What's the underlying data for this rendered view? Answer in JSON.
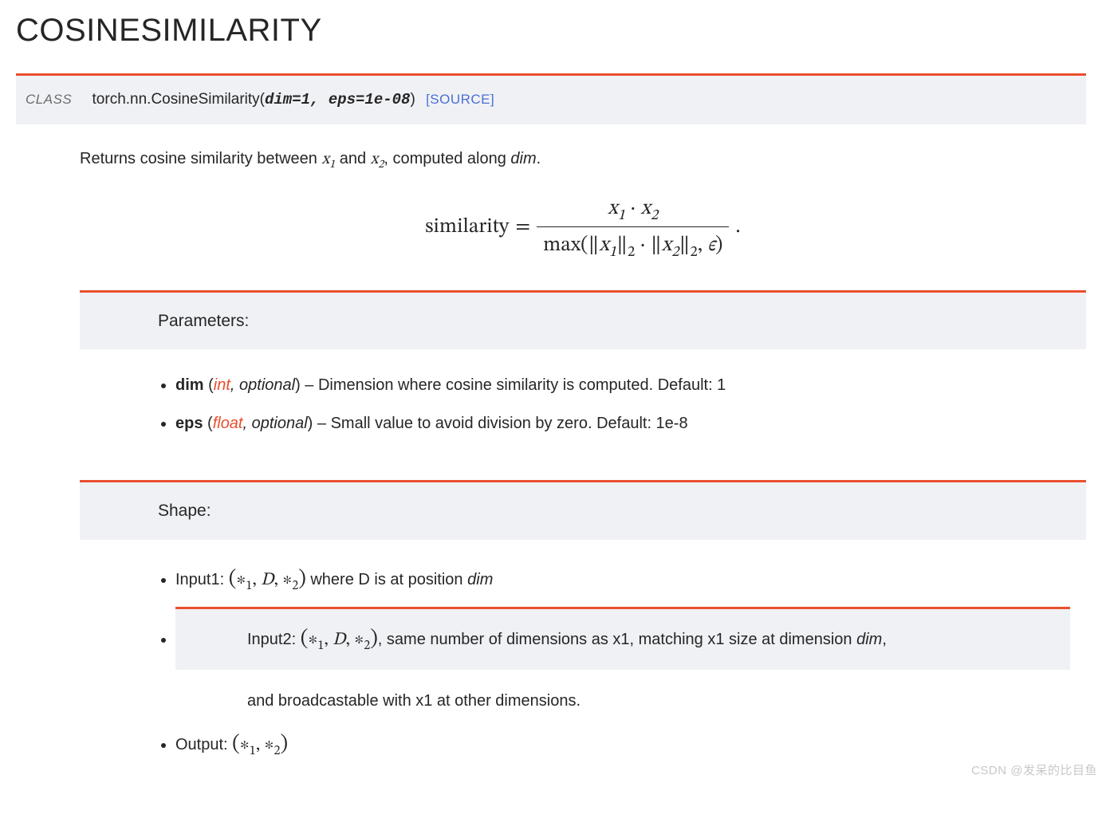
{
  "title": "COSINESIMILARITY",
  "signature": {
    "keyword": "CLASS",
    "path": "torch.nn.CosineSimilarity",
    "open": "(",
    "arg1_name": "dim=1",
    "sep": ", ",
    "arg2_name": "eps=1e-08",
    "close": ")",
    "source": "[SOURCE]"
  },
  "desc": {
    "t1": "Returns cosine similarity between ",
    "x": "x",
    "s1": "1",
    "t2": " and ",
    "s2": "2",
    "t3": ", computed along ",
    "dim": "dim",
    "t4": "."
  },
  "formula": {
    "lhs": "similarity",
    "eq": "=",
    "num": {
      "x": "x",
      "s1": "1",
      "dot": " · ",
      "s2": "2"
    },
    "den": {
      "max": "max(",
      "bb": "∥",
      "x": "x",
      "s1": "1",
      "s2": "2",
      "n2": "2",
      "dot": " · ",
      "comma": ", ",
      "eps": "ϵ",
      "close": ")"
    },
    "period": "."
  },
  "params": {
    "label": "Parameters:",
    "items": [
      {
        "name": "dim",
        "open": " (",
        "type": "int",
        "opt": ", optional",
        "close": ") – ",
        "desc": "Dimension where cosine similarity is computed. Default: 1"
      },
      {
        "name": "eps",
        "open": " (",
        "type": "float",
        "opt": ", optional",
        "close": ") – ",
        "desc": "Small value to avoid division by zero. Default: 1e-8"
      }
    ]
  },
  "shape": {
    "label": "Shape:",
    "input1": {
      "lead": "Input1: ",
      "o": "(",
      "ast": "∗",
      "s1": "1",
      "c1": ", ",
      "D": "D",
      "c2": ", ",
      "s2": "2",
      "close": ")",
      "tail1": " where D is at position ",
      "dim": "dim"
    },
    "input2": {
      "lead": "Input2: ",
      "o": "(",
      "ast": "∗",
      "s1": "1",
      "c1": ", ",
      "D": "D",
      "c2": ", ",
      "s2": "2",
      "close": ")",
      "tail1": ", same number of dimensions as x1, matching x1 size at dimension ",
      "dim": "dim",
      "tail2": ",",
      "tail3": "and broadcastable with x1 at other dimensions."
    },
    "output": {
      "lead": "Output: ",
      "o": "(",
      "ast": "∗",
      "s1": "1",
      "c1": ", ",
      "s2": "2",
      "close": ")"
    }
  },
  "watermark": "CSDN @发呆的比目鱼"
}
